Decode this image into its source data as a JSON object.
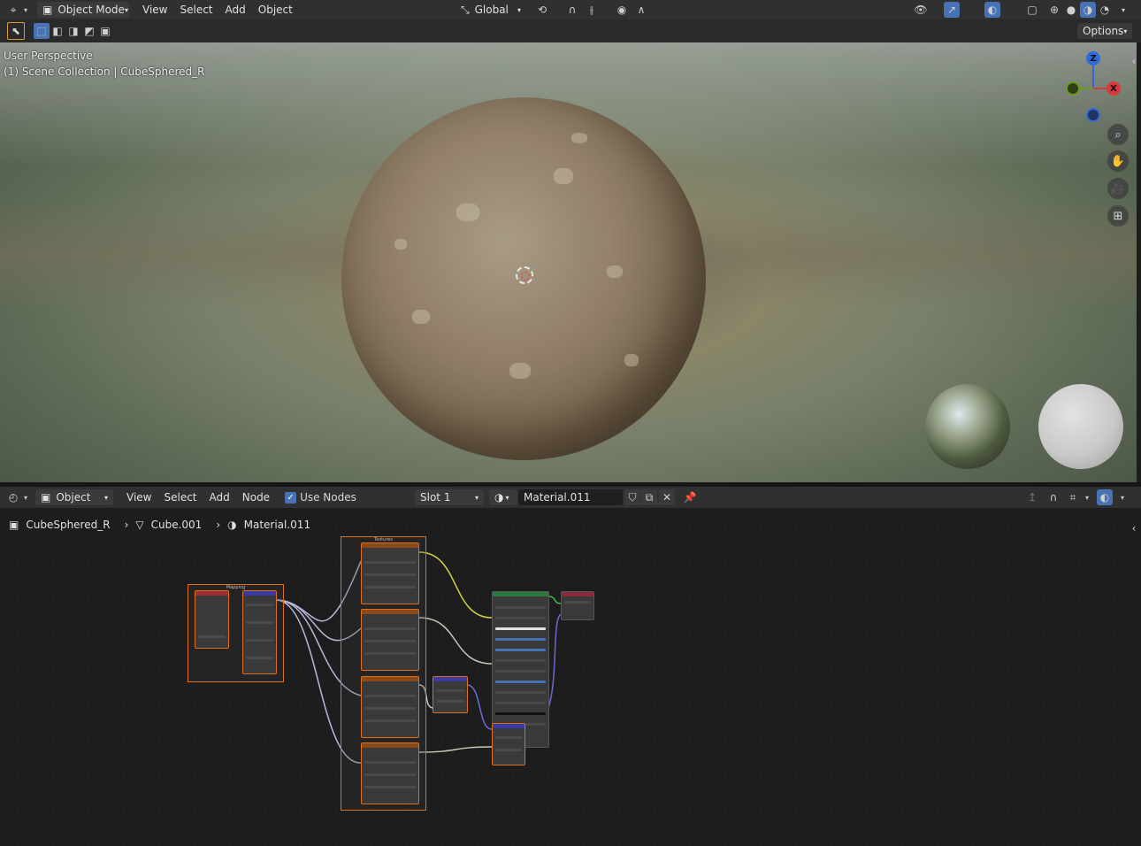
{
  "topbar": {
    "mode": "Object Mode",
    "menus": [
      "View",
      "Select",
      "Add",
      "Object"
    ],
    "orientation": "Global"
  },
  "toolbar": {
    "options_label": "Options"
  },
  "viewport": {
    "perspective": "User Perspective",
    "collection": "(1) Scene Collection | CubeSphered_R",
    "gizmo": {
      "z": "Z",
      "x": "X"
    }
  },
  "node_header": {
    "type": "Object",
    "menus": [
      "View",
      "Select",
      "Add",
      "Node"
    ],
    "use_nodes_label": "Use Nodes",
    "use_nodes_checked": true,
    "slot": "Slot 1",
    "material": "Material.011"
  },
  "breadcrumb": {
    "object": "CubeSphered_R",
    "mesh": "Cube.001",
    "material": "Material.011"
  },
  "frames": {
    "mapping": "Mapping",
    "textures": "Textures"
  },
  "colors": {
    "node_border": "#e06d18",
    "accent_blue": "#4772b3",
    "gizmo_z": "#2f6bd8",
    "gizmo_x": "#d83a3a",
    "gizmo_y": "#6a9a20"
  }
}
